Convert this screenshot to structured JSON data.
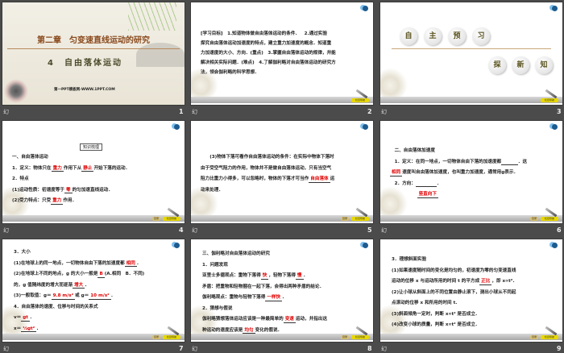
{
  "slides": [
    {
      "number": "1",
      "label": "幻",
      "title": "第二章　匀变速直线运动的研究",
      "subtitle_num": "4",
      "subtitle": "自由落体运动",
      "footer": "第一PPT模板网-WWW.1PPT.COM"
    },
    {
      "number": "2",
      "label": "幻",
      "lines": [
        [
          {
            "t": "[学习目标]　1.知道物体做自由落体运动的条件．　2.通过实验"
          }
        ],
        [
          {
            "t": "探究自由落体运动加速度的特点，建立重力加速度的概念．知道重"
          }
        ],
        [
          {
            "t": "力加速度的大小、方向．(重点)　3.掌握自由落体运动的规律，并能"
          }
        ],
        [
          {
            "t": "解决相关实际问题．(难点)　4.了解伽利略对自由落体运动的研究方"
          }
        ],
        [
          {
            "t": "法，领会伽利略的科学思想．"
          }
        ]
      ],
      "button": "栏目导航"
    },
    {
      "number": "3",
      "label": "幻",
      "circles_top": [
        "自",
        "主",
        "预",
        "习"
      ],
      "circles_bottom": [
        "探",
        "新",
        "知"
      ],
      "button": "栏目导航"
    },
    {
      "number": "4",
      "label": "幻",
      "box": "知识梳理",
      "lines": [
        [
          {
            "t": "一、自由落体运动"
          }
        ],
        [
          {
            "t": "1．定义：物体只在"
          },
          {
            "t": "重力",
            "a": true
          },
          {
            "t": "作用下从"
          },
          {
            "t": "静止",
            "a": true
          },
          {
            "t": "开始下落的运动．"
          }
        ],
        [
          {
            "t": "2．特点"
          }
        ],
        [
          {
            "t": "(1)运动性质：初速度等于"
          },
          {
            "t": "零",
            "a": true
          },
          {
            "t": "的匀加速直线运动．"
          }
        ],
        [
          {
            "t": "(2)受力特点：只受"
          },
          {
            "t": "重力",
            "a": true
          },
          {
            "t": "作用．"
          }
        ]
      ],
      "button_left": "目录",
      "button": "栏目导航"
    },
    {
      "number": "5",
      "label": "幻",
      "lines": [
        [
          {
            "t": "　　(3)物体下落可看作自由落体运动的条件：在实际中物体下落时"
          }
        ],
        [
          {
            "t": "由于受空气阻力的作用，物体并不是做自由落体运动，只有当空气"
          }
        ],
        [
          {
            "t": "阻力比重力小得多，可以忽略时，物体的下落才可当作"
          },
          {
            "t": "自由落体",
            "a": true
          },
          {
            "t": "运"
          }
        ],
        [
          {
            "t": "动来处理．"
          }
        ]
      ],
      "button_left": "目录",
      "button": "栏目导航"
    },
    {
      "number": "6",
      "label": "幻",
      "lines": [
        [
          {
            "t": "　二、自由落体加速度"
          }
        ],
        [
          {
            "t": "　1．定义：在同一地点，一切物体自由下落的加速度都"
          },
          {
            "t": "　　　",
            "a": true
          },
          {
            "t": "．这"
          }
        ],
        [
          {
            "t": "相同",
            "a": true
          },
          {
            "t": "速度叫自由落体加速度，也叫重力加速度，通常用g表示．"
          }
        ],
        [
          {
            "t": "　2．方向："
          },
          {
            "t": "　　　　",
            "a": true
          },
          {
            "t": "．"
          }
        ],
        [
          {
            "t": "　　　　　　"
          },
          {
            "t": "竖直向下",
            "a": true
          }
        ]
      ],
      "button_left": "目录",
      "button": "栏目导航"
    },
    {
      "number": "7",
      "label": "幻",
      "lines": [
        [
          {
            "t": "3．大小"
          }
        ],
        [
          {
            "t": "(1)在地球上的同一地点，一切物体自由下落的加速度都"
          },
          {
            "t": "相同",
            "a": true
          },
          {
            "t": "."
          }
        ],
        [
          {
            "t": "(2)在地球上不同的地点，g 的大小一般是"
          },
          {
            "t": "B",
            "a": true
          },
          {
            "t": "(A.相同　B．不同)"
          }
        ],
        [
          {
            "t": "的，g 值随纬度的增大而逐渐"
          },
          {
            "t": "增大",
            "a": true
          },
          {
            "t": "．"
          }
        ],
        [
          {
            "t": "(3)一般取值：g＝"
          },
          {
            "t": "9.8 m/s²",
            "a": true
          },
          {
            "t": "或 g＝"
          },
          {
            "t": "10 m/s²",
            "a": true
          },
          {
            "t": "．"
          }
        ],
        [
          {
            "t": "4．自由落体的速度、位移与时间的关系式"
          }
        ],
        [
          {
            "t": "v＝"
          },
          {
            "t": "gt",
            "a": true
          },
          {
            "t": "．"
          }
        ],
        [
          {
            "t": "x＝"
          },
          {
            "t": "½gt²",
            "a": true
          },
          {
            "t": "．"
          }
        ]
      ],
      "button_left": "目录",
      "button": "栏目导航"
    },
    {
      "number": "8",
      "label": "幻",
      "lines": [
        [
          {
            "t": "三、伽利略对自由落体运动的研究"
          }
        ],
        [
          {
            "t": "1．问题发现"
          }
        ],
        [
          {
            "t": "亚里士多德观点：重物下落得"
          },
          {
            "t": "快",
            "a": true
          },
          {
            "t": "，轻物下落得"
          },
          {
            "t": "慢",
            "a": true
          },
          {
            "t": "．"
          }
        ],
        [
          {
            "t": "矛盾：把重物和轻物捆在一起下落，会得出两种矛盾的结论．"
          }
        ],
        [
          {
            "t": "伽利略观点：重物与轻物下落得"
          },
          {
            "t": "一样快",
            "a": true
          },
          {
            "t": "．"
          }
        ],
        [
          {
            "t": "2．猜想与假说"
          }
        ],
        [
          {
            "t": "伽利略猜想落体运动应该是一种最简单的"
          },
          {
            "t": "变速",
            "a": true
          },
          {
            "t": "运动，并指出这"
          }
        ],
        [
          {
            "t": "种运动的速度应该是"
          },
          {
            "t": "均匀",
            "a": true
          },
          {
            "t": "变化的假说．"
          }
        ]
      ],
      "button_left": "目录",
      "button": "栏目导航"
    },
    {
      "number": "9",
      "label": "幻",
      "lines": [
        [
          {
            "t": "3．理想斜面实验"
          }
        ],
        [
          {
            "t": "(1)如果速度随时间的变化是均匀的，初速度为零的匀变速直线"
          }
        ],
        [
          {
            "t": "运动的位移 x 与运动所用的时间 t 的平方成"
          },
          {
            "t": "正比",
            "a": true
          },
          {
            "t": "，即 x∝t²．"
          }
        ],
        [
          {
            "t": "(2)让小球从斜面上的不同位置由静止滚下，测出小球从不同起"
          }
        ],
        [
          {
            "t": "点滚动的位移 x 和所用的时间 t."
          }
        ],
        [
          {
            "t": "(3)斜面倾角一定时，判断 x∝t² 是否成立．"
          }
        ],
        [
          {
            "t": "(4)改变小球的质量，判断 x∝t² 是否成立．"
          }
        ]
      ],
      "button_left": "目录",
      "button": "栏目导航"
    }
  ]
}
